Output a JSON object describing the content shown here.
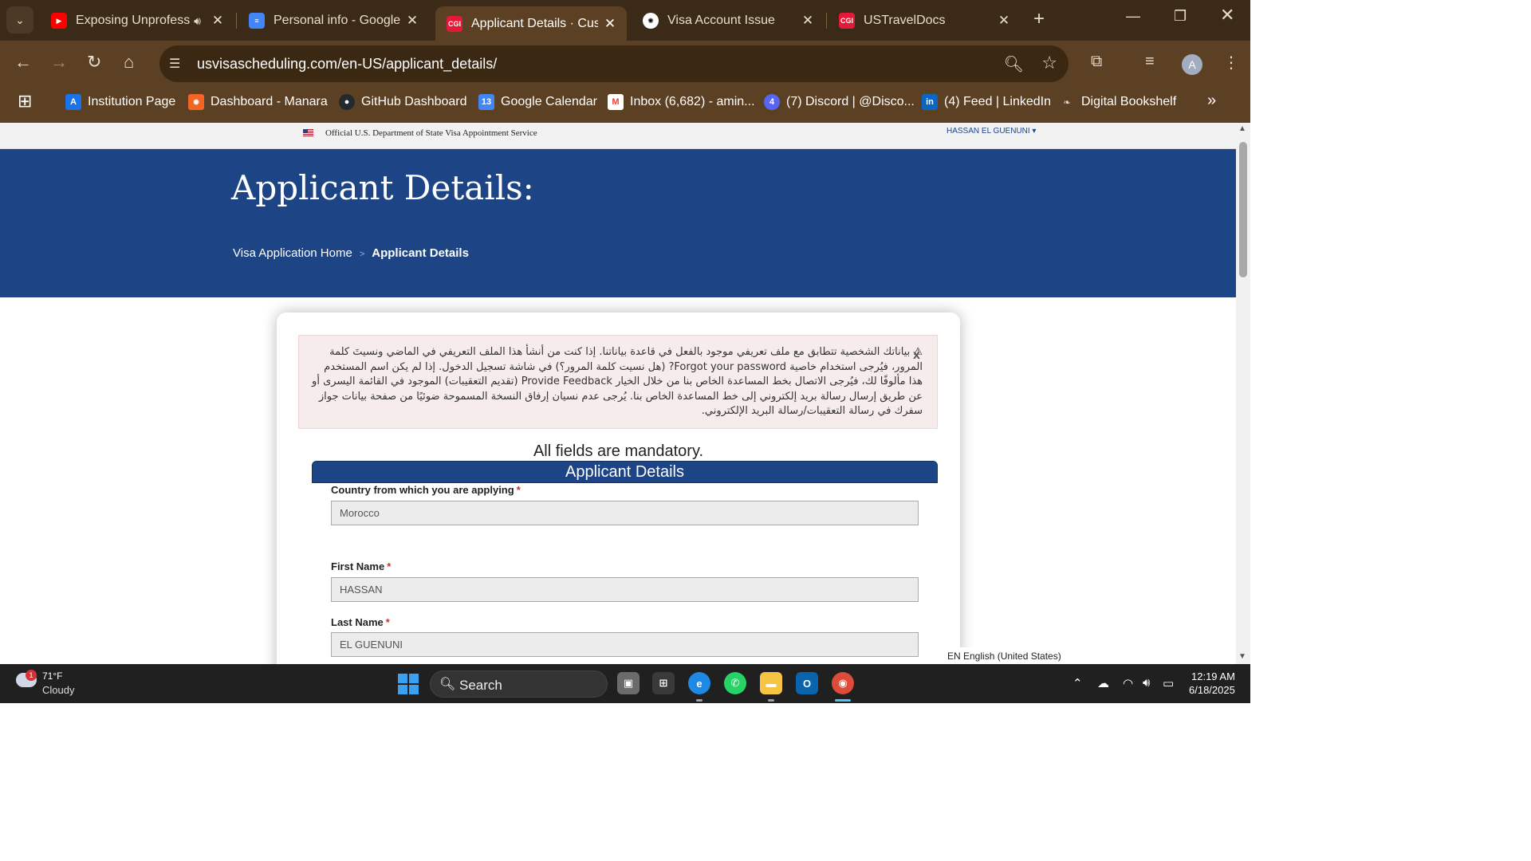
{
  "browser": {
    "tabs": [
      {
        "title": "Exposing Unprofess",
        "favicon": "youtube-icon",
        "color": "#ff0000",
        "glyph": "▶",
        "audio": true
      },
      {
        "title": "Personal info - Google",
        "favicon": "google-docs-icon",
        "color": "#4285f4",
        "glyph": "≡"
      },
      {
        "title": "Applicant Details · Cust",
        "favicon": "cgi-icon",
        "color": "#e31937",
        "glyph": "CGI",
        "active": true
      },
      {
        "title": "Visa Account Issue",
        "favicon": "chatgpt-icon",
        "color": "#ffffff",
        "glyph": "✺"
      },
      {
        "title": "USTravelDocs",
        "favicon": "cgi-icon",
        "color": "#e31937",
        "glyph": "CGI"
      }
    ],
    "url": "usvisascheduling.com/en-US/applicant_details/",
    "profile_initial": "A",
    "bookmarks": [
      {
        "label": "Institution Page",
        "icon": "institution-icon",
        "color": "#1a73e8",
        "glyph": "A"
      },
      {
        "label": "Dashboard - Manara",
        "icon": "manara-icon",
        "color": "#f26522",
        "glyph": "✹"
      },
      {
        "label": "GitHub Dashboard",
        "icon": "github-icon",
        "color": "#24292e",
        "glyph": "●"
      },
      {
        "label": "Google Calendar",
        "icon": "calendar-icon",
        "color": "#4285f4",
        "glyph": "13"
      },
      {
        "label": "Inbox (6,682) - amin...",
        "icon": "gmail-icon",
        "color": "#ea4335",
        "glyph": "M"
      },
      {
        "label": "(7) Discord | @Disco...",
        "icon": "discord-icon",
        "color": "#5865f2",
        "glyph": "4"
      },
      {
        "label": "(4) Feed | LinkedIn",
        "icon": "linkedin-icon",
        "color": "#0a66c2",
        "glyph": "in"
      },
      {
        "label": "Digital Bookshelf",
        "icon": "bookshelf-icon",
        "color": "#333333",
        "glyph": "❧"
      }
    ]
  },
  "site": {
    "official_notice": "Official U.S. Department of State Visa Appointment Service",
    "user_menu": "HASSAN EL GUENUNI ▾",
    "page_title": "Applicant Details:",
    "breadcrumb": {
      "home": "Visa Application Home",
      "separator": ">",
      "current": "Applicant Details"
    }
  },
  "alert": {
    "message": "بياناتك الشخصية تتطابق مع ملف تعريفي موجود بالفعل في قاعدة بياناتنا. إذا كنت من أنشأ هذا الملف التعريفي في الماضي ونسيتَ كلمة المرور، فيُرجى استخدام خاصية Forgot your password? (هل نسيت كلمة المرور؟) في شاشة تسجيل الدخول. إذا لم يكن اسم المستخدم هذا مألوفًا لك، فيُرجى الاتصال بخط المساعدة الخاص بنا من خلال الخيار Provide Feedback (تقديم التعقيبات) الموجود في القائمة اليسرى أو عن طريق إرسال رسالة بريد إلكتروني إلى خط المساعدة الخاص بنا. يُرجى عدم نسيان إرفاق النسخة المسموحة ضوئيًا من صفحة بيانات جواز سفرك في رسالة التعقيبات/رسالة البريد الإلكتروني.",
    "close_label": "x"
  },
  "form": {
    "mandatory_note": "All fields are mandatory.",
    "section_title": "Applicant Details",
    "required_marker": "*",
    "fields": [
      {
        "label": "Country from which you are applying",
        "value": "Morocco"
      },
      {
        "label": "First Name",
        "value": "HASSAN"
      },
      {
        "label": "Last Name",
        "value": "EL GUENUNI"
      }
    ]
  },
  "language_indicator": "EN English (United States)",
  "taskbar": {
    "weather_temp": "71°F",
    "weather_condition": "Cloudy",
    "weather_badge": "1",
    "search_label": "Search",
    "time": "12:19 AM",
    "date": "6/18/2025"
  },
  "colors": {
    "banner": "#1d4485",
    "chrome_tabstrip": "#3b2a18",
    "chrome_toolbar": "#5b4023",
    "required": "#c0392b"
  }
}
